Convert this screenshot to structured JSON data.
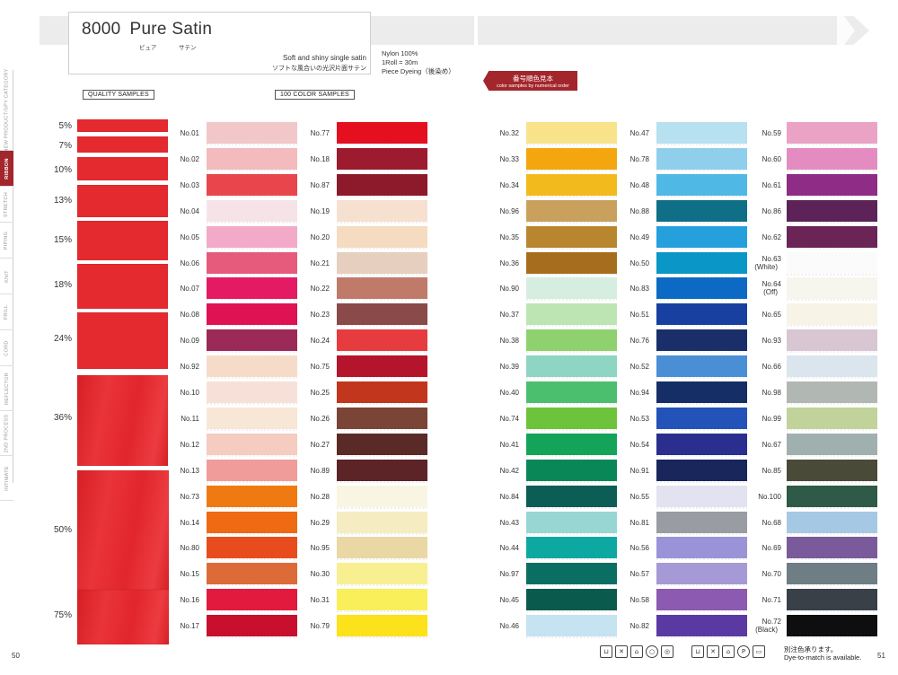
{
  "header": {
    "product_number": "8000",
    "product_name": "Pure Satin",
    "ruby_1": "ピュア",
    "ruby_2": "サテン",
    "description_en": "Soft and shiny single satin",
    "description_jp": "ソフトな風合いの光沢片面サテン",
    "spec_lines": [
      "Nylon 100%",
      "1Roll = 30m",
      "Piece Dyeing（後染め）"
    ]
  },
  "order_tag": {
    "line1": "番号順色見本",
    "line2": "color samples by numerical order"
  },
  "section_labels": {
    "quality": "QUALITY SAMPLES",
    "colors": "100 COLOR SAMPLES"
  },
  "side_nav": [
    "NEW PRODUCT/SPY CATEGORY",
    "RIBBON",
    "STRETCH",
    "PIPING",
    "KNIT",
    "FRILL",
    "CORD",
    "REFLECTOR",
    "2ND PROCESS",
    "INTIMATE"
  ],
  "side_nav_active": "RIBBON",
  "quality_samples": [
    "5%",
    "7%",
    "10%",
    "13%",
    "15%",
    "18%",
    "24%",
    "36%",
    "50%",
    "75%"
  ],
  "color_columns": [
    [
      {
        "label": "No.01",
        "color": "#f2c7c9"
      },
      {
        "label": "No.02",
        "color": "#f3bbbd"
      },
      {
        "label": "No.03",
        "color": "#e9454d"
      },
      {
        "label": "No.04",
        "color": "#f6e3e8"
      },
      {
        "label": "No.05",
        "color": "#f2aac8"
      },
      {
        "label": "No.06",
        "color": "#e65b7c"
      },
      {
        "label": "No.07",
        "color": "#e41b64"
      },
      {
        "label": "No.08",
        "color": "#df1254"
      },
      {
        "label": "No.09",
        "color": "#9c2a58"
      },
      {
        "label": "No.92",
        "color": "#f6dcc8"
      },
      {
        "label": "No.10",
        "color": "#f6e0d7"
      },
      {
        "label": "No.11",
        "color": "#f8e6d6"
      },
      {
        "label": "No.12",
        "color": "#f4ccc0"
      },
      {
        "label": "No.13",
        "color": "#ef9c9a"
      },
      {
        "label": "No.73",
        "color": "#f07a12"
      },
      {
        "label": "No.14",
        "color": "#ee6a13"
      },
      {
        "label": "No.80",
        "color": "#e84c1d"
      },
      {
        "label": "No.15",
        "color": "#dd6b38"
      },
      {
        "label": "No.16",
        "color": "#e11a3e"
      },
      {
        "label": "No.17",
        "color": "#c8102e"
      }
    ],
    [
      {
        "label": "No.77",
        "color": "#e40f1f"
      },
      {
        "label": "No.18",
        "color": "#9c1b2e"
      },
      {
        "label": "No.87",
        "color": "#8c1a2a"
      },
      {
        "label": "No.19",
        "color": "#f6e0cf"
      },
      {
        "label": "No.20",
        "color": "#f5dbc0"
      },
      {
        "label": "No.21",
        "color": "#e6cfbf"
      },
      {
        "label": "No.22",
        "color": "#c07a6a"
      },
      {
        "label": "No.23",
        "color": "#8a4a4a"
      },
      {
        "label": "No.24",
        "color": "#e63c40"
      },
      {
        "label": "No.75",
        "color": "#b5152c"
      },
      {
        "label": "No.25",
        "color": "#c2361e"
      },
      {
        "label": "No.26",
        "color": "#7a4436"
      },
      {
        "label": "No.27",
        "color": "#5a2a26"
      },
      {
        "label": "No.89",
        "color": "#5c2427"
      },
      {
        "label": "No.28",
        "color": "#f8f6e2"
      },
      {
        "label": "No.29",
        "color": "#f5ecc2"
      },
      {
        "label": "No.95",
        "color": "#ead8a4"
      },
      {
        "label": "No.30",
        "color": "#f8f090"
      },
      {
        "label": "No.31",
        "color": "#f9ef5a"
      },
      {
        "label": "No.79",
        "color": "#fbe21a"
      }
    ],
    [
      {
        "label": "No.32",
        "color": "#f8e38a"
      },
      {
        "label": "No.33",
        "color": "#f4a60f"
      },
      {
        "label": "No.34",
        "color": "#f3ba1d"
      },
      {
        "label": "No.96",
        "color": "#c9a15d"
      },
      {
        "label": "No.35",
        "color": "#b8862e"
      },
      {
        "label": "No.36",
        "color": "#a76d1e"
      },
      {
        "label": "No.90",
        "color": "#d6eedf"
      },
      {
        "label": "No.37",
        "color": "#bde5b3"
      },
      {
        "label": "No.38",
        "color": "#8fd06f"
      },
      {
        "label": "No.39",
        "color": "#8fd5c3"
      },
      {
        "label": "No.40",
        "color": "#4cbf6f"
      },
      {
        "label": "No.74",
        "color": "#6dc43a"
      },
      {
        "label": "No.41",
        "color": "#13a45a"
      },
      {
        "label": "No.42",
        "color": "#0a8757"
      },
      {
        "label": "No.84",
        "color": "#0b5d55"
      },
      {
        "label": "No.43",
        "color": "#98d6d4"
      },
      {
        "label": "No.44",
        "color": "#0ea8a2"
      },
      {
        "label": "No.97",
        "color": "#0b6e63"
      },
      {
        "label": "No.45",
        "color": "#0a5a4e"
      },
      {
        "label": "No.46",
        "color": "#c6e3f2"
      }
    ],
    [
      {
        "label": "No.47",
        "color": "#b7e0f0"
      },
      {
        "label": "No.78",
        "color": "#8fcfec"
      },
      {
        "label": "No.48",
        "color": "#4fb8e4"
      },
      {
        "label": "No.88",
        "color": "#0e6f86"
      },
      {
        "label": "No.49",
        "color": "#25a0dd"
      },
      {
        "label": "No.50",
        "color": "#0a96c6"
      },
      {
        "label": "No.83",
        "color": "#0c6ac5"
      },
      {
        "label": "No.51",
        "color": "#1740a1"
      },
      {
        "label": "No.76",
        "color": "#1a2f6a"
      },
      {
        "label": "No.52",
        "color": "#4a8ed6"
      },
      {
        "label": "No.94",
        "color": "#152e66"
      },
      {
        "label": "No.53",
        "color": "#2352b8"
      },
      {
        "label": "No.54",
        "color": "#2a2e8e"
      },
      {
        "label": "No.91",
        "color": "#18265c"
      },
      {
        "label": "No.55",
        "color": "#e2e2f0"
      },
      {
        "label": "No.81",
        "color": "#9a9ca4"
      },
      {
        "label": "No.56",
        "color": "#9b93d8"
      },
      {
        "label": "No.57",
        "color": "#a59ad6"
      },
      {
        "label": "No.58",
        "color": "#8c5ab0"
      },
      {
        "label": "No.82",
        "color": "#5a3aa2"
      }
    ],
    [
      {
        "label": "No.59",
        "color": "#eaa3c4"
      },
      {
        "label": "No.60",
        "color": "#e48cc2"
      },
      {
        "label": "No.61",
        "color": "#8e2c86"
      },
      {
        "label": "No.86",
        "color": "#5c2358"
      },
      {
        "label": "No.62",
        "color": "#6a2456"
      },
      {
        "label": "No.63\n(White)",
        "color": "#fbfbfb"
      },
      {
        "label": "No.64\n(Off)",
        "color": "#f6f5ee"
      },
      {
        "label": "No.65",
        "color": "#f7f3e6"
      },
      {
        "label": "No.93",
        "color": "#d8c6d2"
      },
      {
        "label": "No.66",
        "color": "#dbe5ee"
      },
      {
        "label": "No.98",
        "color": "#b1b8b4"
      },
      {
        "label": "No.99",
        "color": "#c1d39a"
      },
      {
        "label": "No.67",
        "color": "#9fb0ae"
      },
      {
        "label": "No.85",
        "color": "#4a4a38"
      },
      {
        "label": "No.100",
        "color": "#2f5a48"
      },
      {
        "label": "No.68",
        "color": "#a5c9e4"
      },
      {
        "label": "No.69",
        "color": "#7a5a9a"
      },
      {
        "label": "No.70",
        "color": "#6f7d84"
      },
      {
        "label": "No.71",
        "color": "#3a4048"
      },
      {
        "label": "No.72\n(Black)",
        "color": "#0e0e10"
      }
    ]
  ],
  "footer": {
    "page_left": "50",
    "page_right": "51",
    "dye_note_jp": "別注色承ります。",
    "dye_note_en": "Dye-to-match is available.",
    "care_icons_left": [
      "wash-icon",
      "no-bleach-icon",
      "iron-icon",
      "dry-icon",
      "tumble-icon"
    ],
    "care_icons_right": [
      "wash-30-icon",
      "no-bleach-icon",
      "iron-low-icon",
      "dryclean-p-icon",
      "flat-dry-icon"
    ]
  }
}
